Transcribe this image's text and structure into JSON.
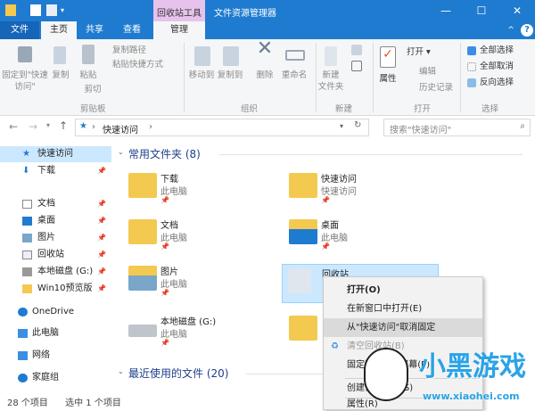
{
  "title": {
    "app": "文件资源管理器",
    "context_tab": "回收站工具"
  },
  "window_buttons": {
    "minimize": "—",
    "maximize": "☐",
    "close": "✕"
  },
  "tabs": [
    {
      "label": "文件"
    },
    {
      "label": "主页"
    },
    {
      "label": "共享"
    },
    {
      "label": "查看"
    },
    {
      "label": "管理"
    }
  ],
  "ribbon": {
    "clipboard": {
      "pin": "固定到\"快速访问\"",
      "copy": "复制",
      "paste": "粘贴",
      "copy_path": "复制路径",
      "paste_shortcut": "粘贴快捷方式",
      "cut": "剪切",
      "group": "剪贴板"
    },
    "organize": {
      "move_to": "移动到",
      "copy_to": "复制到",
      "delete": "删除",
      "rename": "重命名",
      "group": "组织"
    },
    "new": {
      "new_folder": "新建\n文件夹",
      "group": "新建"
    },
    "open": {
      "properties": "属性",
      "open": "打开 ▾",
      "edit": "编辑",
      "history": "历史记录",
      "group": "打开"
    },
    "select": {
      "select_all": "全部选择",
      "select_none": "全部取消",
      "invert": "反向选择",
      "group": "选择"
    }
  },
  "address": {
    "path": "快速访问",
    "separator": "›",
    "search_placeholder": "搜索\"快速访问\""
  },
  "sidebar": [
    {
      "label": "快速访问",
      "icon": "star"
    },
    {
      "label": "下载",
      "icon": "download",
      "pinned": true
    },
    {
      "label": "文档",
      "icon": "document",
      "pinned": true
    },
    {
      "label": "桌面",
      "icon": "desktop",
      "pinned": true
    },
    {
      "label": "图片",
      "icon": "pictures",
      "pinned": true
    },
    {
      "label": "回收站",
      "icon": "recycle-bin",
      "pinned": true
    },
    {
      "label": "本地磁盘 (G:)",
      "icon": "drive",
      "pinned": true
    },
    {
      "label": "Win10预览版",
      "icon": "folder",
      "pinned": true
    },
    {
      "label": "OneDrive",
      "icon": "cloud"
    },
    {
      "label": "此电脑",
      "icon": "computer"
    },
    {
      "label": "网络",
      "icon": "network"
    },
    {
      "label": "家庭组",
      "icon": "homegroup"
    }
  ],
  "content": {
    "frequent_header": "常用文件夹 (8)",
    "recent_header": "最近使用的文件 (20)",
    "items": [
      {
        "name": "下载",
        "sub": "此电脑"
      },
      {
        "name": "快速访问",
        "sub": "快速访问"
      },
      {
        "name": "文档",
        "sub": "此电脑"
      },
      {
        "name": "桌面",
        "sub": "此电脑"
      },
      {
        "name": "图片",
        "sub": "此电脑"
      },
      {
        "name": "回收站",
        "sub": ""
      },
      {
        "name": "本地磁盘 (G:)",
        "sub": "此电脑"
      },
      {
        "name": "",
        "sub": ""
      }
    ]
  },
  "context_menu": [
    {
      "label": "打开(O)"
    },
    {
      "label": "在新窗口中打开(E)"
    },
    {
      "label": "从\"快速访问\"取消固定"
    },
    {
      "label": "清空回收站(B)"
    },
    {
      "label": "固定到\"开始\"屏幕(P)"
    },
    {
      "label": "创建快捷方式(S)"
    },
    {
      "label": "属性(R)"
    }
  ],
  "status": {
    "count": "28 个项目",
    "selected": "选中 1 个项目"
  },
  "watermark": {
    "brand": "小黑游戏",
    "url": "www.xiaohei.com"
  },
  "colors": {
    "accent": "#1f7bd0",
    "context_tab": "#e7c3ec",
    "selection": "#cce8ff"
  }
}
